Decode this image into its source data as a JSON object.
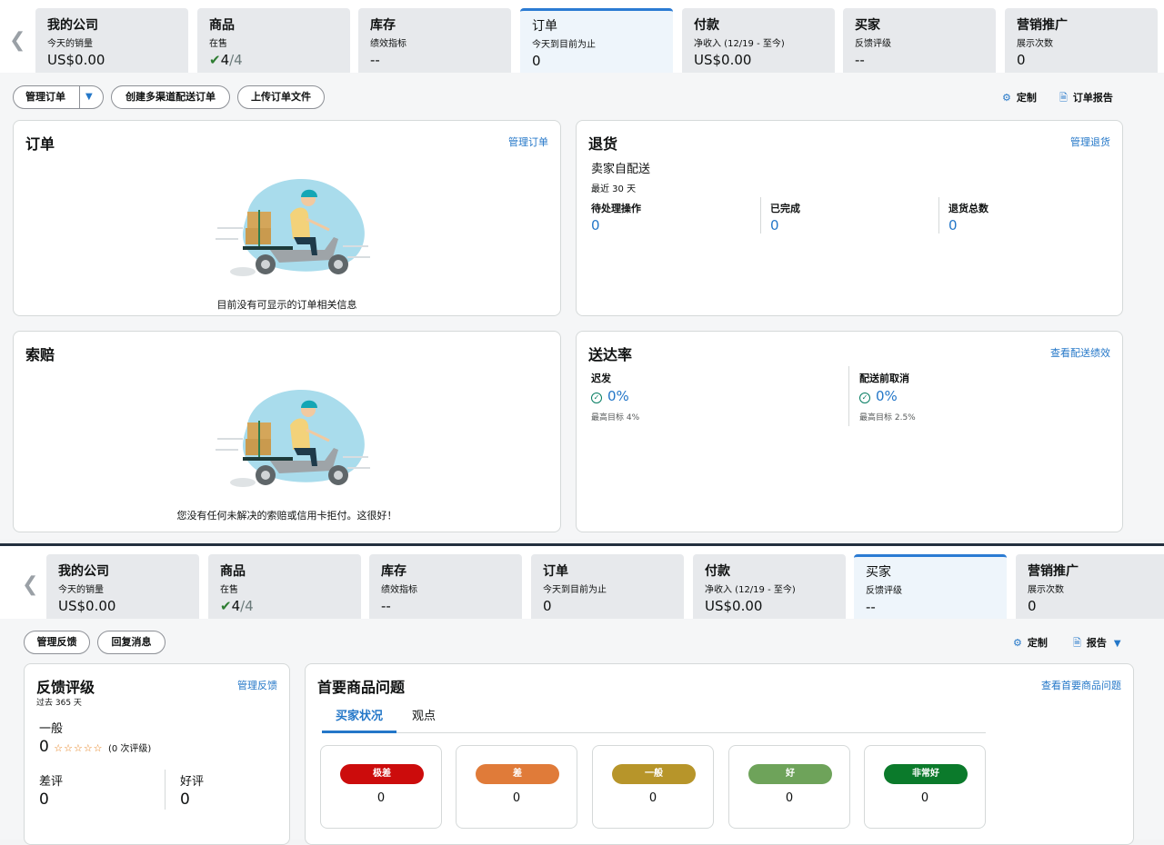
{
  "top": {
    "tabs": [
      {
        "title": "我的公司",
        "sub": "今天的销量",
        "value": "US$0.00"
      },
      {
        "title": "商品",
        "sub": "在售",
        "value_a": "4",
        "value_b": "/4"
      },
      {
        "title": "库存",
        "sub": "绩效指标",
        "value": "--"
      },
      {
        "title": "订单",
        "sub": "今天到目前为止",
        "value": "0"
      },
      {
        "title": "付款",
        "sub": "净收入 (12/19 - 至今)",
        "value": "US$0.00"
      },
      {
        "title": "买家",
        "sub": "反馈评级",
        "value": "--"
      },
      {
        "title": "营销推广",
        "sub": "展示次数",
        "value": "0"
      }
    ],
    "actions": {
      "manage_orders": "管理订单",
      "create_mcf": "创建多渠道配送订单",
      "upload_orders": "上传订单文件"
    },
    "customize": "定制",
    "order_report": "订单报告",
    "orders_card": {
      "title": "订单",
      "link": "管理订单",
      "empty": "目前没有可显示的订单相关信息"
    },
    "returns_card": {
      "title": "退货",
      "link": "管理退货",
      "subtitle": "卖家自配送",
      "period": "最近 30 天",
      "stats": [
        {
          "label": "待处理操作",
          "value": "0"
        },
        {
          "label": "已完成",
          "value": "0"
        },
        {
          "label": "退货总数",
          "value": "0"
        }
      ]
    },
    "claims_card": {
      "title": "索赔",
      "empty": "您没有任何未解决的索赔或信用卡拒付。这很好！"
    },
    "delivery_card": {
      "title": "送达率",
      "link": "查看配送绩效",
      "stats": [
        {
          "label": "迟发",
          "value": "0%",
          "target": "最高目标 4%"
        },
        {
          "label": "配送前取消",
          "value": "0%",
          "target": "最高目标 2.5%"
        }
      ]
    }
  },
  "bottom": {
    "tabs": [
      {
        "title": "我的公司",
        "sub": "今天的销量",
        "value": "US$0.00"
      },
      {
        "title": "商品",
        "sub": "在售",
        "value_a": "4",
        "value_b": "/4"
      },
      {
        "title": "库存",
        "sub": "绩效指标",
        "value": "--"
      },
      {
        "title": "订单",
        "sub": "今天到目前为止",
        "value": "0"
      },
      {
        "title": "付款",
        "sub": "净收入 (12/19 - 至今)",
        "value": "US$0.00"
      },
      {
        "title": "买家",
        "sub": "反馈评级",
        "value": "--"
      },
      {
        "title": "营销推广",
        "sub": "展示次数",
        "value": "0"
      }
    ],
    "actions": {
      "manage_feedback": "管理反馈",
      "reply": "回复消息"
    },
    "customize": "定制",
    "report": "报告",
    "feedback_card": {
      "title": "反馈评级",
      "link": "管理反馈",
      "period": "过去 365 天",
      "level": "一般",
      "score": "0",
      "stars": "☆☆☆☆☆",
      "count": "(0 次评级)",
      "neg_label": "差评",
      "neg_value": "0",
      "pos_label": "好评",
      "pos_value": "0"
    },
    "product_card": {
      "title": "首要商品问题",
      "link": "查看首要商品问题",
      "tab1": "买家状况",
      "tab2": "观点",
      "ratings": [
        {
          "label": "极差",
          "value": "0",
          "color": "#cc0c0c"
        },
        {
          "label": "差",
          "value": "0",
          "color": "#e07b39"
        },
        {
          "label": "一般",
          "value": "0",
          "color": "#b7952a"
        },
        {
          "label": "好",
          "value": "0",
          "color": "#6ea35a"
        },
        {
          "label": "非常好",
          "value": "0",
          "color": "#0b7a2b"
        }
      ]
    }
  }
}
